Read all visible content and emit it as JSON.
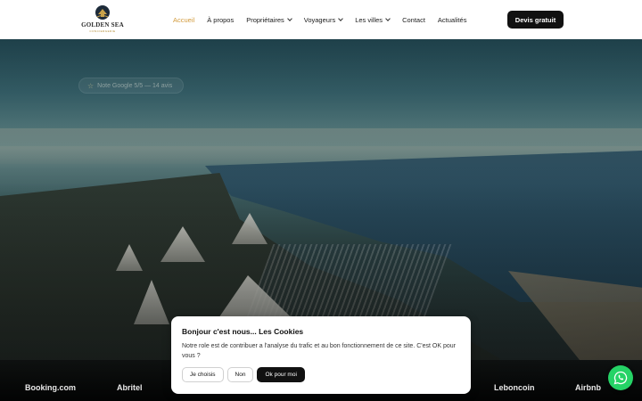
{
  "header": {
    "logo": {
      "brand": "GOLDEN SEA",
      "sub": "CONCIERGERIE"
    },
    "nav": [
      {
        "label": "Accueil",
        "active": true,
        "dropdown": false
      },
      {
        "label": "À propos",
        "active": false,
        "dropdown": false
      },
      {
        "label": "Propriétaires",
        "active": false,
        "dropdown": true
      },
      {
        "label": "Voyageurs",
        "active": false,
        "dropdown": true
      },
      {
        "label": "Les villes",
        "active": false,
        "dropdown": true
      },
      {
        "label": "Contact",
        "active": false,
        "dropdown": false
      },
      {
        "label": "Actualités",
        "active": false,
        "dropdown": false
      }
    ],
    "cta_label": "Devis gratuit"
  },
  "hero": {
    "rating_text": "Note Google 5/5 — 14 avis",
    "rating_icon": "star-icon"
  },
  "partners": [
    "Booking.com",
    "Abritel",
    "Leboncoin",
    "Airbnb"
  ],
  "cookie": {
    "title": "Bonjour c'est nous... Les Cookies",
    "text": "Notre role est de contribuer a l'analyse du trafic et au bon fonctionnement de ce site. C'est OK pour vous ?",
    "buttons": {
      "choose": "Je choisis",
      "no": "Non",
      "ok": "Ok pour moi"
    }
  },
  "colors": {
    "accent": "#d29a3b",
    "cta": "#111111",
    "whatsapp": "#25d366"
  },
  "whatsapp_icon": "whatsapp-icon"
}
